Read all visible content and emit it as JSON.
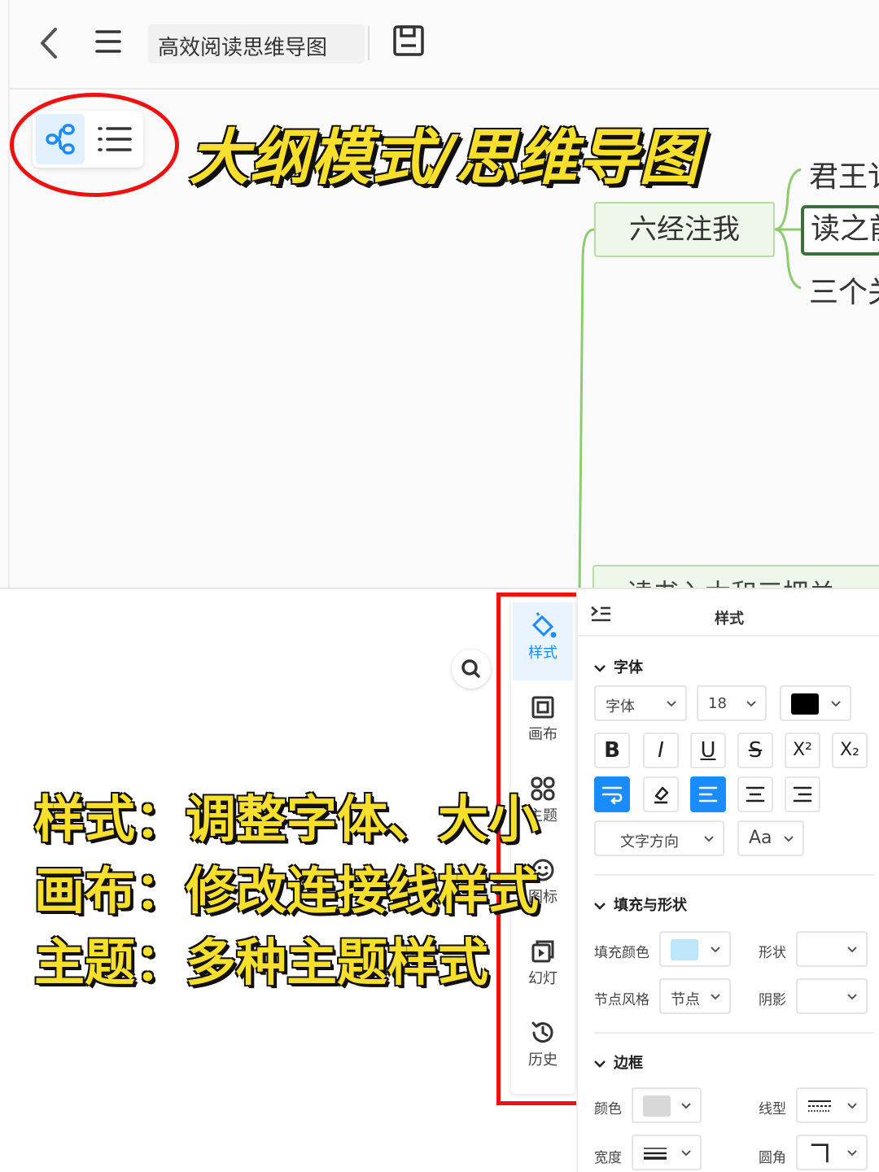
{
  "header": {
    "doc_title": "高效阅读思维导图"
  },
  "mode_switch": {
    "active": "mindmap"
  },
  "overlay": {
    "title": "大纲模式/思维导图",
    "notes": [
      "样式：调整字体、大小",
      "画布：修改连接线样式",
      "主题：多种主题样式"
    ]
  },
  "mindmap": {
    "main_node": "六经注我",
    "children": [
      "君王讠",
      "读之前",
      "三个关"
    ],
    "bottom_node": "读书入木和三把关"
  },
  "side_tabs": [
    {
      "label": "样式",
      "icon": "style-icon",
      "active": true
    },
    {
      "label": "画布",
      "icon": "canvas-icon"
    },
    {
      "label": "主题",
      "icon": "theme-icon"
    },
    {
      "label": "图标",
      "icon": "emoji-icon"
    },
    {
      "label": "幻灯",
      "icon": "slideshow-icon"
    },
    {
      "label": "历史",
      "icon": "history-icon"
    }
  ],
  "panel": {
    "title": "样式",
    "font": {
      "heading": "字体",
      "family": "字体",
      "size": "18",
      "color": "#000000",
      "buttons": [
        "B",
        "I",
        "U",
        "S",
        "X²",
        "X₂"
      ],
      "direction": "文字方向",
      "case": "Aa"
    },
    "fill": {
      "heading": "填充与形状",
      "fill_color_label": "填充颜色",
      "fill_color": "#bde6fb",
      "shape_label": "形状",
      "node_style_label": "节点风格",
      "node_style": "节点",
      "shadow_label": "阴影"
    },
    "border": {
      "heading": "边框",
      "color_label": "颜色",
      "color": "#d8d8d8",
      "line_label": "线型",
      "width_label": "宽度",
      "corner_label": "圆角"
    }
  }
}
